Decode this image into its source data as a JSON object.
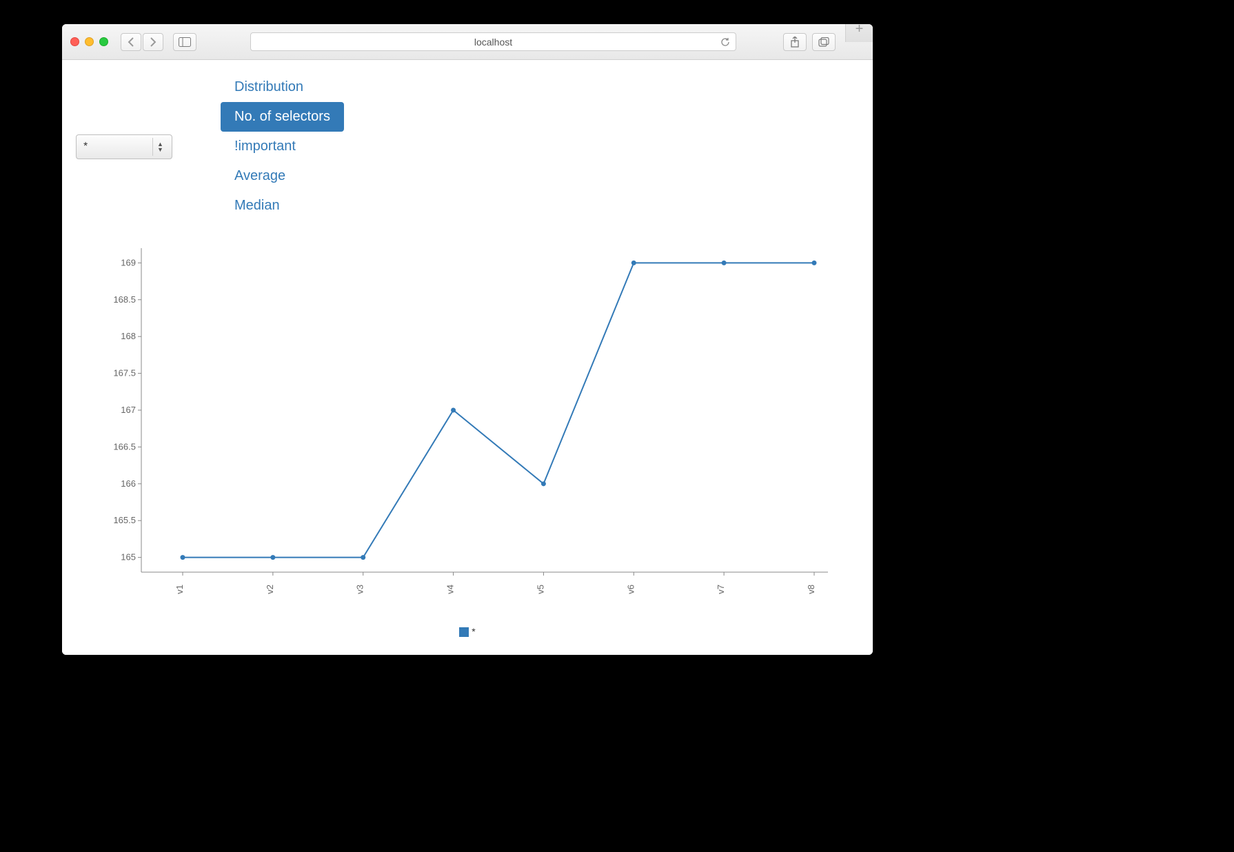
{
  "browser": {
    "address": "localhost"
  },
  "controls": {
    "selector_value": "*",
    "tabs": [
      {
        "label": "Distribution",
        "active": false
      },
      {
        "label": "No. of selectors",
        "active": true
      },
      {
        "label": "!important",
        "active": false
      },
      {
        "label": "Average",
        "active": false
      },
      {
        "label": "Median",
        "active": false
      }
    ]
  },
  "chart_data": {
    "type": "line",
    "categories": [
      "v1",
      "v2",
      "v3",
      "v4",
      "v5",
      "v6",
      "v7",
      "v8"
    ],
    "values": [
      165,
      165,
      165,
      167,
      166,
      169,
      169,
      169
    ],
    "y_ticks": [
      165,
      165.5,
      166,
      166.5,
      167,
      167.5,
      168,
      168.5,
      169
    ],
    "ylim": [
      164.8,
      169.2
    ],
    "series_name": "*",
    "line_color": "#337ab7",
    "point_color": "#337ab7"
  },
  "legend": {
    "label": "*"
  }
}
